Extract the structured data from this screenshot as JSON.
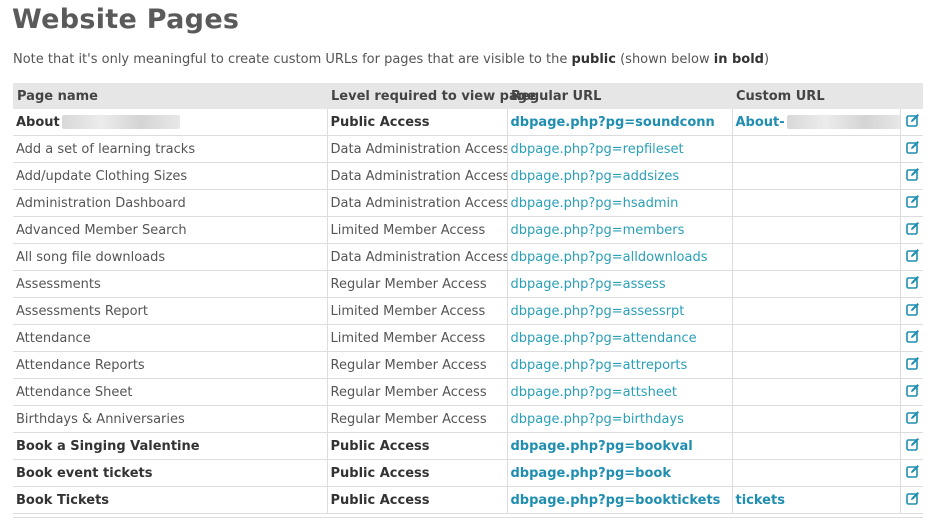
{
  "page": {
    "title": "Website Pages",
    "note_before": "Note that it's only meaningful to create custom URLs for pages that are visible to the ",
    "note_public": "public",
    "note_middle": " (shown below ",
    "note_bold": "in bold",
    "note_after": ")"
  },
  "table": {
    "headers": [
      "Page name",
      "Level required to view page",
      "Regular URL",
      "Custom URL",
      ""
    ],
    "rows": [
      {
        "name": "About",
        "level": "Public Access",
        "url": "dbpage.php?pg=soundconn",
        "custom": "About-",
        "bold": true,
        "name_redacted": true,
        "custom_redacted": true
      },
      {
        "name": "Add a set of learning tracks",
        "level": "Data Administration Access",
        "url": "dbpage.php?pg=repfileset",
        "custom": "",
        "bold": false
      },
      {
        "name": "Add/update Clothing Sizes",
        "level": "Data Administration Access",
        "url": "dbpage.php?pg=addsizes",
        "custom": "",
        "bold": false
      },
      {
        "name": "Administration Dashboard",
        "level": "Data Administration Access",
        "url": "dbpage.php?pg=hsadmin",
        "custom": "",
        "bold": false
      },
      {
        "name": "Advanced Member Search",
        "level": "Limited Member Access",
        "url": "dbpage.php?pg=members",
        "custom": "",
        "bold": false
      },
      {
        "name": "All song file downloads",
        "level": "Data Administration Access",
        "url": "dbpage.php?pg=alldownloads",
        "custom": "",
        "bold": false
      },
      {
        "name": "Assessments",
        "level": "Regular Member Access",
        "url": "dbpage.php?pg=assess",
        "custom": "",
        "bold": false
      },
      {
        "name": "Assessments Report",
        "level": "Limited Member Access",
        "url": "dbpage.php?pg=assessrpt",
        "custom": "",
        "bold": false
      },
      {
        "name": "Attendance",
        "level": "Limited Member Access",
        "url": "dbpage.php?pg=attendance",
        "custom": "",
        "bold": false
      },
      {
        "name": "Attendance Reports",
        "level": "Regular Member Access",
        "url": "dbpage.php?pg=attreports",
        "custom": "",
        "bold": false
      },
      {
        "name": "Attendance Sheet",
        "level": "Regular Member Access",
        "url": "dbpage.php?pg=attsheet",
        "custom": "",
        "bold": false
      },
      {
        "name": "Birthdays & Anniversaries",
        "level": "Regular Member Access",
        "url": "dbpage.php?pg=birthdays",
        "custom": "",
        "bold": false
      },
      {
        "name": "Book a Singing Valentine",
        "level": "Public Access",
        "url": "dbpage.php?pg=bookval",
        "custom": "",
        "bold": true
      },
      {
        "name": "Book event tickets",
        "level": "Public Access",
        "url": "dbpage.php?pg=book",
        "custom": "",
        "bold": true
      },
      {
        "name": "Book Tickets",
        "level": "Public Access",
        "url": "dbpage.php?pg=booktickets",
        "custom": "tickets",
        "bold": true
      }
    ]
  },
  "icons": {
    "edit": "edit-icon"
  },
  "colors": {
    "link": "#2a9fb8",
    "header_bg": "#e6e6e6",
    "edit_icon": "#1f8eb0"
  }
}
